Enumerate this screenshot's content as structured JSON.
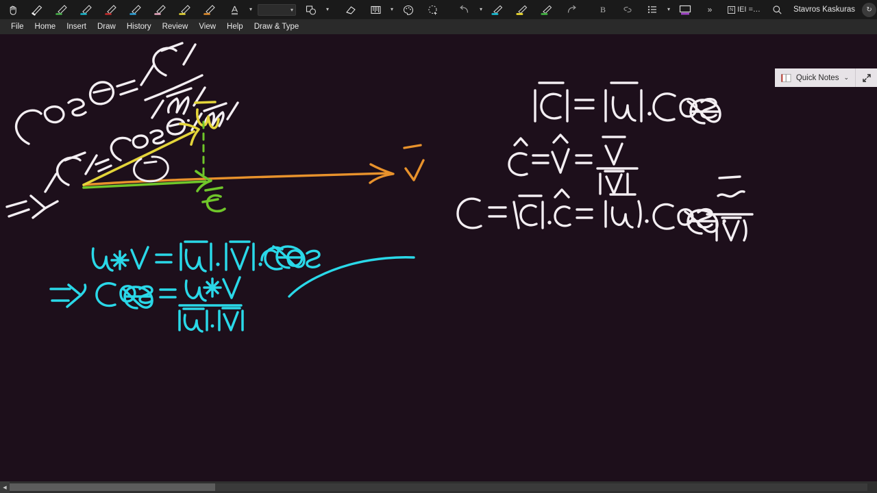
{
  "titlebar": {
    "pen_tools": [
      {
        "name": "lasso-hand-tool",
        "label": "Hand",
        "color": "#ffffff",
        "type": "hand"
      },
      {
        "name": "pen-tool-white",
        "label": "Pen",
        "color": "#f2f2f2",
        "type": "pen"
      },
      {
        "name": "pen-tool-green",
        "label": "Pen Green",
        "color": "#45b048",
        "type": "pen"
      },
      {
        "name": "pen-tool-cyan",
        "label": "Pen Cyan",
        "color": "#16b4c9",
        "type": "pen"
      },
      {
        "name": "pen-tool-red",
        "label": "Pen Red",
        "color": "#c22a2a",
        "type": "pen"
      },
      {
        "name": "pen-tool-blue",
        "label": "Pen Blue",
        "color": "#2a9fd6",
        "type": "pen"
      },
      {
        "name": "pen-tool-pink",
        "label": "Pen Pink",
        "color": "#e6a5bd",
        "type": "pen"
      },
      {
        "name": "pen-tool-yellow",
        "label": "Pen Yellow",
        "color": "#e8d833",
        "type": "pen"
      },
      {
        "name": "pen-tool-orange",
        "label": "Pen Orange",
        "color": "#e08b2a",
        "type": "pen"
      }
    ],
    "font_color": {
      "name": "font-color-picker",
      "label": "A",
      "color": "#c9c9c9"
    },
    "color_swatch": {
      "name": "color-swatch",
      "value": ""
    },
    "shapes": {
      "name": "shapes-tool",
      "label": "Shapes"
    },
    "eraser": {
      "name": "eraser-tool",
      "label": "Eraser"
    },
    "ruler": {
      "name": "ruler-tool",
      "label": "Ruler"
    },
    "ink_color": {
      "name": "ink-color-tool",
      "label": "Ink Color"
    },
    "lasso": {
      "name": "lasso-select-tool",
      "label": "Lasso Select"
    },
    "undo": {
      "name": "undo-button",
      "label": "Undo"
    },
    "highlighters": [
      {
        "name": "highlighter-cyan",
        "label": "Highlighter Cyan",
        "color": "#18b9cf"
      },
      {
        "name": "highlighter-yellow",
        "label": "Highlighter Yellow",
        "color": "#ead72e"
      },
      {
        "name": "highlighter-green",
        "label": "Highlighter Green",
        "color": "#3fae3f"
      }
    ],
    "redo": {
      "name": "redo-button",
      "label": "Redo"
    },
    "bold": {
      "name": "bold-button",
      "label": "B"
    },
    "link": {
      "name": "link-button",
      "label": "Link"
    },
    "list": {
      "name": "bullet-list-button",
      "label": "Bullets"
    },
    "page_view": {
      "name": "page-view-button",
      "label": "Page View",
      "accent": "#a245c9"
    },
    "overflow": {
      "name": "toolbar-overflow-button",
      "label": "»"
    },
    "document_name": "IEI =…",
    "search": {
      "name": "search-button",
      "label": "Search"
    },
    "user_name": "Stavros Kaskuras",
    "sync_badge": {
      "name": "sync-status-icon",
      "label": "↻"
    },
    "ribbon_display": {
      "name": "ribbon-display-button",
      "label": "Ribbon Display Options"
    },
    "window_controls": {
      "minimize": "—",
      "maximize": "❐",
      "close": "✕"
    }
  },
  "menubar": {
    "items": [
      {
        "name": "menu-file",
        "label": "File"
      },
      {
        "name": "menu-home",
        "label": "Home"
      },
      {
        "name": "menu-insert",
        "label": "Insert"
      },
      {
        "name": "menu-draw",
        "label": "Draw"
      },
      {
        "name": "menu-history",
        "label": "History"
      },
      {
        "name": "menu-review",
        "label": "Review"
      },
      {
        "name": "menu-view",
        "label": "View"
      },
      {
        "name": "menu-help",
        "label": "Help"
      },
      {
        "name": "menu-draw-and-type",
        "label": "Draw & Type"
      }
    ]
  },
  "quick_notes": {
    "label": "Quick Notes",
    "chevron": "⌄",
    "expand": "⤢"
  },
  "canvas": {
    "background_color": "#1d0f1b",
    "ink_colors": {
      "white": "#f3eef2",
      "yellow": "#e3d43a",
      "orange": "#e8922c",
      "green": "#6fc62a",
      "cyan": "#2ad8e8"
    },
    "handwriting": {
      "top_left_rotated": [
        "CosΘ = |C̄| / |ū|",
        "⇒ |C̄| = CosΘ · |ū|"
      ],
      "diagram_labels": {
        "u_vector": "ū",
        "v_vector": "v̄",
        "c_vector": "c̄",
        "angle": "Θ"
      },
      "right_equations": [
        "|C̄| = |ū| · CosΘ",
        "ĉ = v̂ = v̄ / |v̄|",
        "C = |c̄| · ĉ = |ū| · CosΘ · v̄ / |v̄|"
      ],
      "cyan_equations": [
        "u✶v = |ū| · |v̄| · CosΘ",
        "⇒ CosΘ = (u✶v) / (|ū| · |v̄|)"
      ]
    }
  },
  "scrollbar": {
    "left_arrow": "◀",
    "right_arrow": "▶"
  }
}
